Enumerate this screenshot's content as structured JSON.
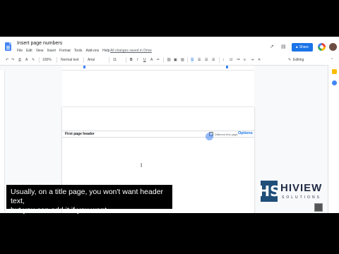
{
  "window": {
    "doc_title": "Insert page numbers",
    "menu": [
      "File",
      "Edit",
      "View",
      "Insert",
      "Format",
      "Tools",
      "Add-ons",
      "Help"
    ],
    "saved_status": "All changes saved in Drive",
    "share_label": "Share"
  },
  "toolbar": {
    "zoom": "100%",
    "style": "Normal text",
    "font": "Arial",
    "size": "11",
    "bold": "B",
    "italic": "I",
    "underline": "U",
    "text_color": "A",
    "mode": "Editing"
  },
  "document": {
    "header_label": "First page header",
    "different_first_page": "Different first page",
    "options_label": "Options"
  },
  "subtitle": {
    "line1": "Usually, on a title page, you won't want header text,",
    "line2": "but you can add it if you want."
  },
  "logo": {
    "mark": "HS",
    "name": "HIVIEW",
    "sub": "SOLUTIONS"
  },
  "icons": {
    "docs": "docs-icon",
    "share_lock": "lock-icon",
    "google": "google-account-icon"
  },
  "colors": {
    "accent": "#1a73e8",
    "docs_blue": "#4285f4",
    "logo_navy": "#1f4e79"
  }
}
